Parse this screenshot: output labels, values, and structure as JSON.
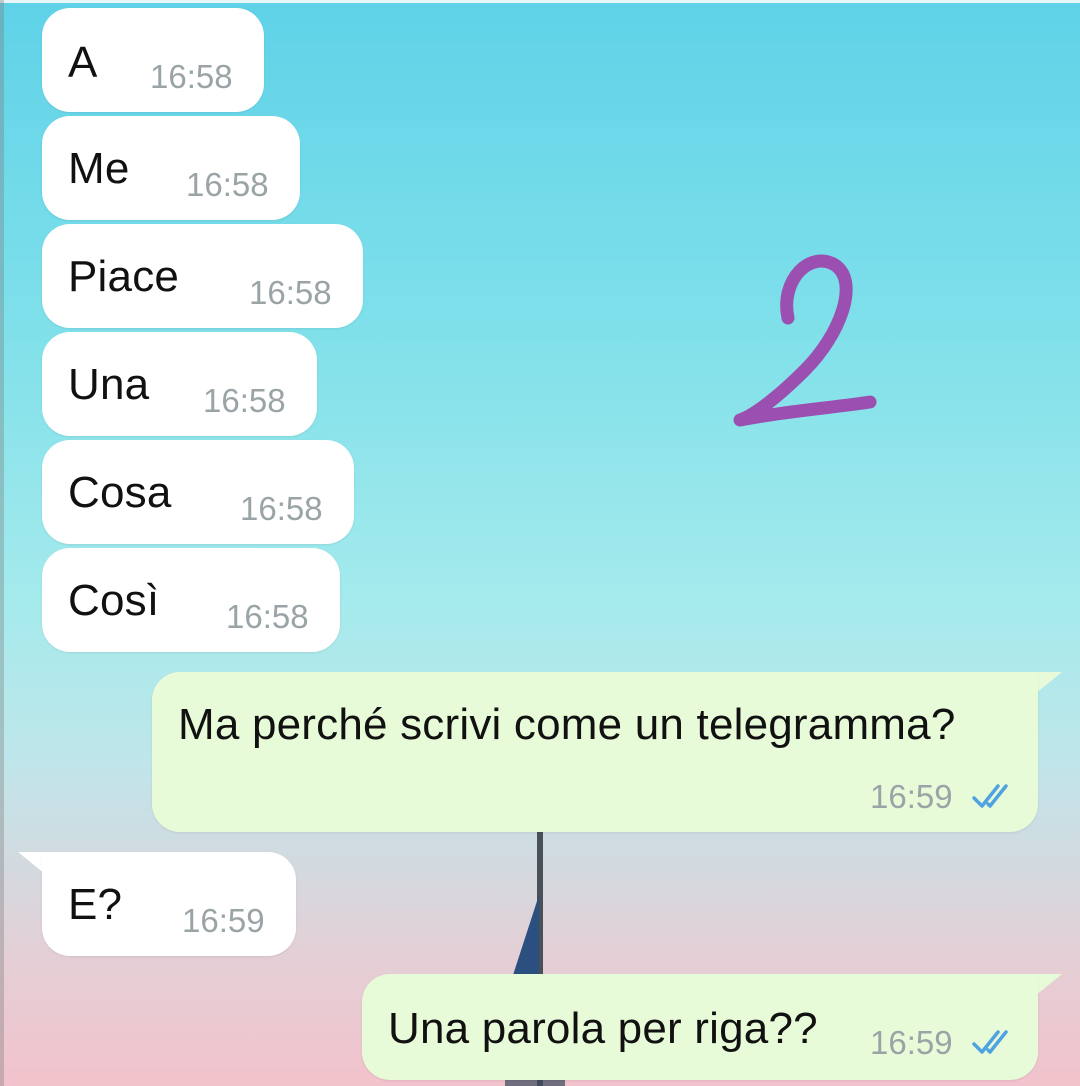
{
  "messages": [
    {
      "text": "A",
      "time": "16:58",
      "direction": "incoming"
    },
    {
      "text": "Me",
      "time": "16:58",
      "direction": "incoming"
    },
    {
      "text": "Piace",
      "time": "16:58",
      "direction": "incoming"
    },
    {
      "text": "Una",
      "time": "16:58",
      "direction": "incoming"
    },
    {
      "text": "Cosa",
      "time": "16:58",
      "direction": "incoming"
    },
    {
      "text": "Così",
      "time": "16:58",
      "direction": "incoming"
    },
    {
      "text": "Ma perché scrivi come un telegramma?",
      "time": "16:59",
      "direction": "outgoing",
      "status": "read-double-check"
    },
    {
      "text": "E?",
      "time": "16:59",
      "direction": "incoming"
    },
    {
      "text": "Una parola per riga??",
      "time": "16:59",
      "direction": "outgoing",
      "status": "read-double-check"
    }
  ],
  "annotation": {
    "text": "2",
    "color": "#9b4fb0"
  },
  "colors": {
    "incoming_bubble": "#ffffff",
    "outgoing_bubble": "#e8fbd9",
    "read_check": "#4fa3e0",
    "time_text": "#9aa4a6"
  }
}
